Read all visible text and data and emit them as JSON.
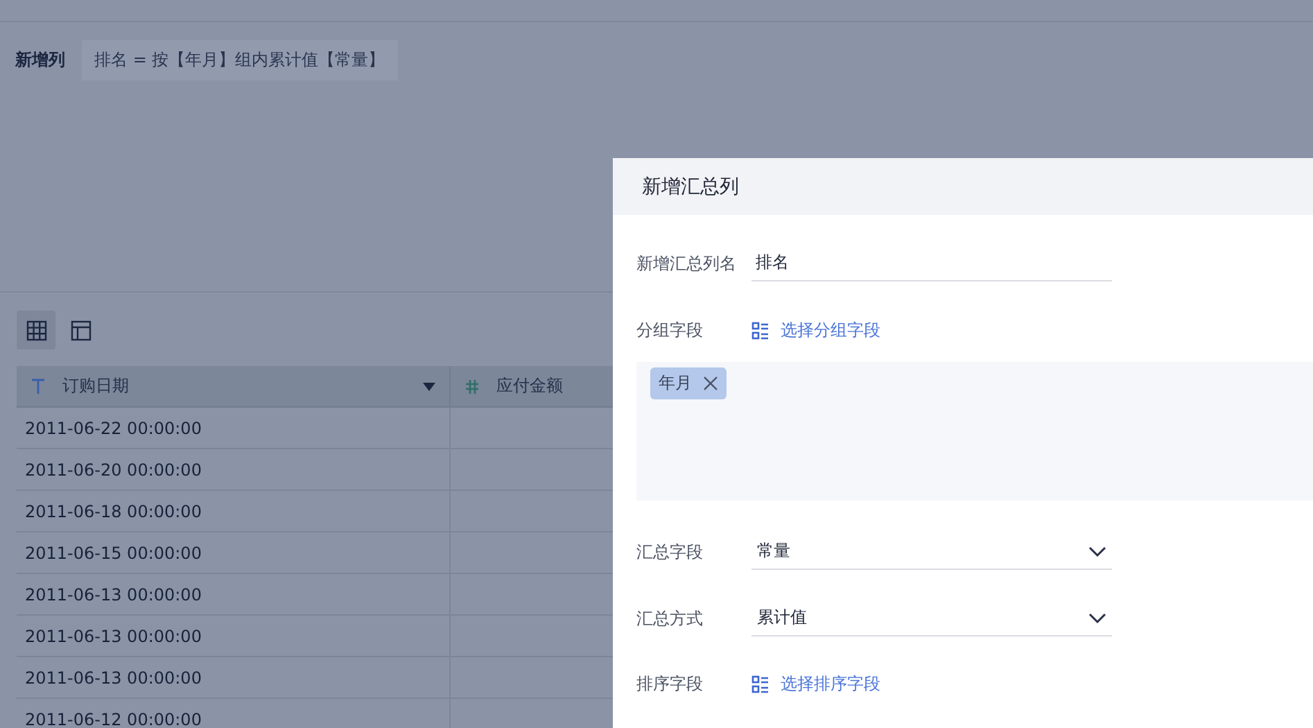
{
  "formula": {
    "label": "新增列",
    "expression": "排名 = 按【年月】组内累计值【常量】"
  },
  "view_toggle": [
    {
      "kind": "grid",
      "selected": true
    },
    {
      "kind": "layout",
      "selected": false
    }
  ],
  "table": {
    "columns": [
      {
        "kind": "text",
        "name": "订购日期",
        "dropdown": true
      },
      {
        "kind": "number",
        "name": "应付金额"
      }
    ],
    "rows": [
      [
        "2011-06-22 00:00:00",
        ""
      ],
      [
        "2011-06-20 00:00:00",
        ""
      ],
      [
        "2011-06-18 00:00:00",
        ""
      ],
      [
        "2011-06-15 00:00:00",
        ""
      ],
      [
        "2011-06-13 00:00:00",
        ""
      ],
      [
        "2011-06-13 00:00:00",
        ""
      ],
      [
        "2011-06-13 00:00:00",
        ""
      ],
      [
        "2011-06-12 00:00:00",
        ""
      ]
    ]
  },
  "dialog": {
    "title": "新增汇总列",
    "fields": [
      {
        "kind": "input",
        "label": "新增汇总列名",
        "value": "排名"
      },
      {
        "kind": "picker",
        "label": "分组字段",
        "action": "选择分组字段",
        "tags": [
          "年月"
        ]
      },
      {
        "kind": "select",
        "label": "汇总字段",
        "value": "常量"
      },
      {
        "kind": "select",
        "label": "汇总方式",
        "value": "累计值"
      },
      {
        "kind": "picker",
        "label": "排序字段",
        "action": "选择排序字段"
      }
    ]
  }
}
